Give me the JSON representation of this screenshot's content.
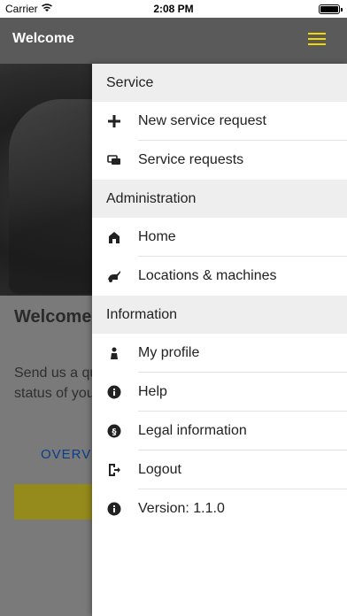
{
  "status_bar": {
    "carrier": "Carrier",
    "time": "2:08 PM"
  },
  "app_bar": {
    "title": "Welcome"
  },
  "background": {
    "heading": "Welcome to the Kärcher Service",
    "body": "Send us a quick service request or check the status of your request.",
    "link": "OVERVIEW",
    "button": "+"
  },
  "drawer": {
    "service": {
      "header": "Service",
      "items": [
        {
          "label": "New service request",
          "icon": "plus-icon"
        },
        {
          "label": "Service requests",
          "icon": "chat-icon"
        }
      ]
    },
    "administration": {
      "header": "Administration",
      "items": [
        {
          "label": "Home",
          "icon": "home-icon"
        },
        {
          "label": "Locations & machines",
          "icon": "machine-icon"
        }
      ]
    },
    "information": {
      "header": "Information",
      "items": [
        {
          "label": "My profile",
          "icon": "profile-icon"
        },
        {
          "label": "Help",
          "icon": "info-icon"
        },
        {
          "label": "Legal information",
          "icon": "paragraph-icon"
        },
        {
          "label": "Logout",
          "icon": "logout-icon"
        },
        {
          "label": "Version: 1.1.0",
          "icon": "info-icon"
        }
      ]
    }
  },
  "colors": {
    "accent": "#f5d800",
    "app_bar": "#5a5a5a",
    "section_bg": "#eeeeee"
  }
}
